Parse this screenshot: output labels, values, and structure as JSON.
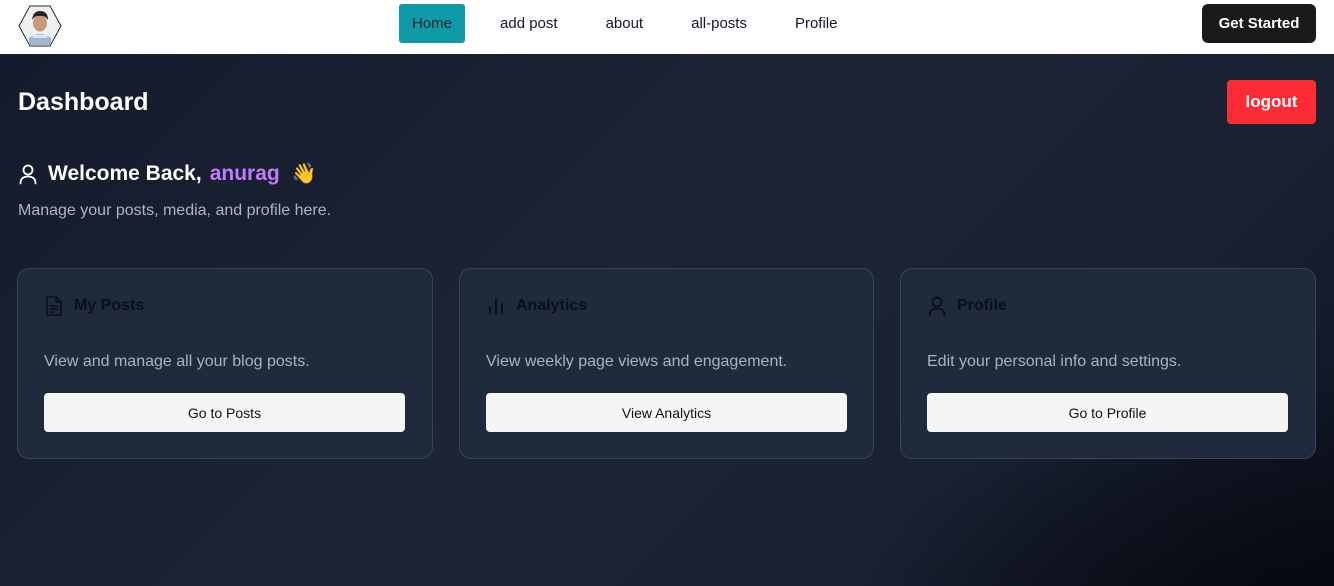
{
  "nav": {
    "items": [
      {
        "label": "Home",
        "active": true
      },
      {
        "label": "add post",
        "active": false
      },
      {
        "label": "about",
        "active": false
      },
      {
        "label": "all-posts",
        "active": false
      },
      {
        "label": "Profile",
        "active": false
      }
    ],
    "cta_label": "Get Started"
  },
  "dashboard": {
    "title": "Dashboard",
    "logout_label": "logout",
    "welcome_text": "Welcome Back,",
    "username": "anurag",
    "wave_emoji": "👋",
    "subtitle": "Manage your posts, media, and profile here."
  },
  "cards": [
    {
      "icon": "document-icon",
      "title": "My Posts",
      "description": "View and manage all your blog posts.",
      "button": "Go to Posts"
    },
    {
      "icon": "bar-chart-icon",
      "title": "Analytics",
      "description": "View weekly page views and engagement.",
      "button": "View Analytics"
    },
    {
      "icon": "user-icon",
      "title": "Profile",
      "description": "Edit your personal info and settings.",
      "button": "Go to Profile"
    }
  ],
  "colors": {
    "accent_active_tab": "#0e9aa7",
    "logout_red": "#fb2c36",
    "username_purple": "#c27aff",
    "background": "#111827",
    "card": "#1f2a3c"
  }
}
